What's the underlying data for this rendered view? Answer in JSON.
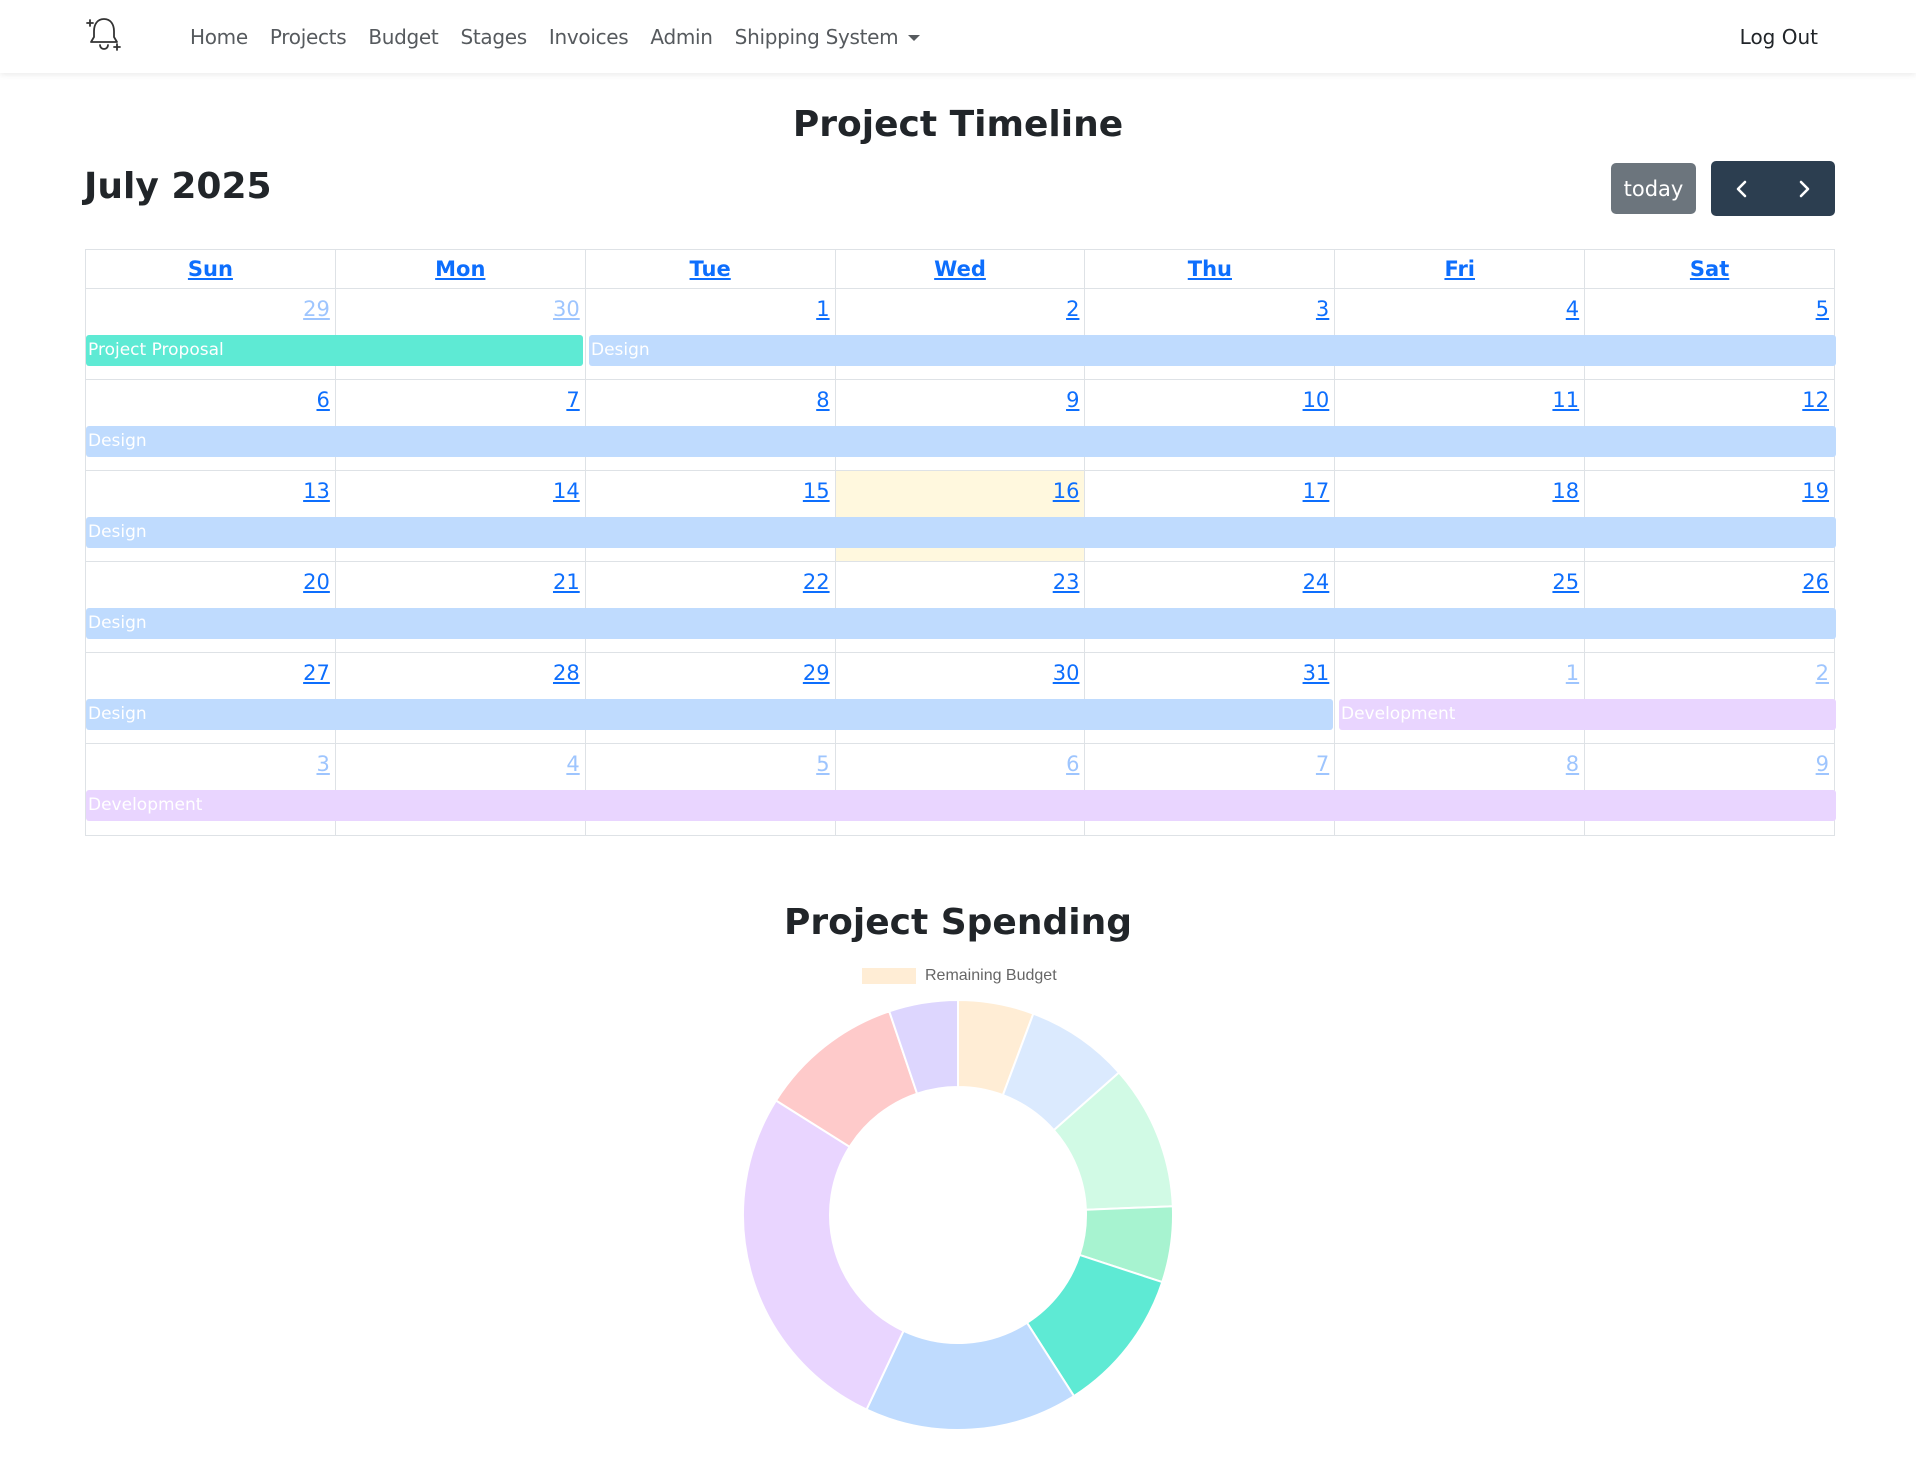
{
  "nav": {
    "links": [
      "Home",
      "Projects",
      "Budget",
      "Stages",
      "Invoices",
      "Admin",
      "Shipping System"
    ],
    "logout": "Log Out"
  },
  "page_title": "Project Timeline",
  "calendar": {
    "month_label": "July 2025",
    "today_label": "today",
    "weekdays": [
      "Sun",
      "Mon",
      "Tue",
      "Wed",
      "Thu",
      "Fri",
      "Sat"
    ],
    "weeks": [
      {
        "days": [
          "29",
          "30",
          "1",
          "2",
          "3",
          "4",
          "5"
        ],
        "other": [
          0,
          1
        ]
      },
      {
        "days": [
          "6",
          "7",
          "8",
          "9",
          "10",
          "11",
          "12"
        ],
        "other": []
      },
      {
        "days": [
          "13",
          "14",
          "15",
          "16",
          "17",
          "18",
          "19"
        ],
        "other": [],
        "today": 3
      },
      {
        "days": [
          "20",
          "21",
          "22",
          "23",
          "24",
          "25",
          "26"
        ],
        "other": []
      },
      {
        "days": [
          "27",
          "28",
          "29",
          "30",
          "31",
          "1",
          "2"
        ],
        "other": [
          5,
          6
        ]
      },
      {
        "days": [
          "3",
          "4",
          "5",
          "6",
          "7",
          "8",
          "9"
        ],
        "other": [
          0,
          1,
          2,
          3,
          4,
          5,
          6
        ]
      }
    ],
    "events": [
      {
        "week": 0,
        "start": 0,
        "end": 1,
        "title": "Project Proposal",
        "color": "#5eead4"
      },
      {
        "week": 0,
        "start": 2,
        "end": 6,
        "title": "Design",
        "color": "#bfdbfe"
      },
      {
        "week": 1,
        "start": 0,
        "end": 6,
        "title": "Design",
        "color": "#bfdbfe"
      },
      {
        "week": 2,
        "start": 0,
        "end": 6,
        "title": "Design",
        "color": "#bfdbfe"
      },
      {
        "week": 3,
        "start": 0,
        "end": 6,
        "title": "Design",
        "color": "#bfdbfe"
      },
      {
        "week": 4,
        "start": 0,
        "end": 4,
        "title": "Design",
        "color": "#bfdbfe"
      },
      {
        "week": 4,
        "start": 5,
        "end": 6,
        "title": "Development",
        "color": "#e9d5ff"
      },
      {
        "week": 5,
        "start": 0,
        "end": 6,
        "title": "Development",
        "color": "#e9d5ff"
      }
    ]
  },
  "spending": {
    "title": "Project Spending",
    "legend_label": "Remaining Budget",
    "legend_color": "#ffedd5"
  },
  "chart_data": {
    "type": "pie",
    "categories": [
      "Remaining Budget"
    ],
    "slices": [
      {
        "value": 5.5,
        "color": "#ffedd5"
      },
      {
        "value": 7.5,
        "color": "#dbeafe"
      },
      {
        "value": 10.5,
        "color": "#d1fae5"
      },
      {
        "value": 5.5,
        "color": "#a7f3d0"
      },
      {
        "value": 10.5,
        "color": "#5eead4"
      },
      {
        "value": 15.5,
        "color": "#bfdbfe"
      },
      {
        "value": 26,
        "color": "#e9d5ff"
      },
      {
        "value": 10.5,
        "color": "#fecaca"
      },
      {
        "value": 5,
        "color": "#ddd6fe"
      }
    ],
    "legend": "top"
  }
}
